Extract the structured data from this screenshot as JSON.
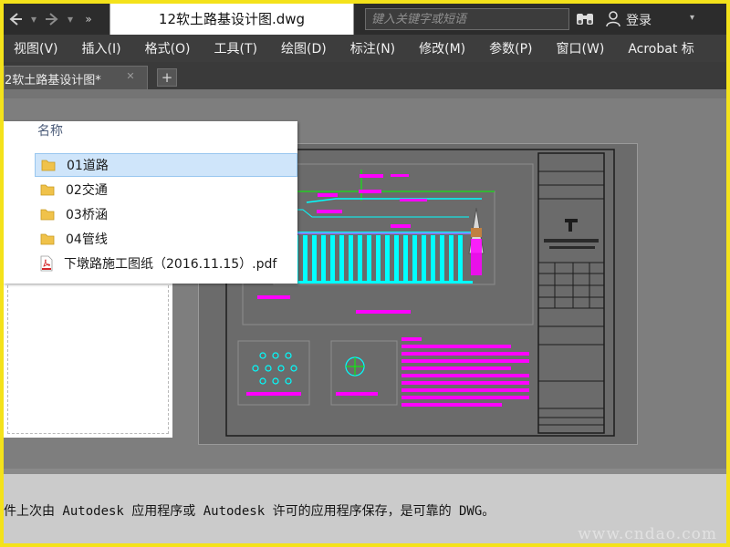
{
  "titlebar": {
    "document_title": "12软土路基设计图.dwg",
    "search_placeholder": "键入关键字或短语",
    "login_label": "登录",
    "back_icon": "back-arrow-icon",
    "forward_icon": "forward-arrow-icon",
    "binoculars_icon": "binoculars-icon",
    "user_icon": "user-icon"
  },
  "menubar": {
    "items": [
      "视图(V)",
      "插入(I)",
      "格式(O)",
      "工具(T)",
      "绘图(D)",
      "标注(N)",
      "修改(M)",
      "参数(P)",
      "窗口(W)",
      "Acrobat 标"
    ]
  },
  "tabs": {
    "active_tab": "2软土路基设计图*",
    "add_tab_icon": "plus-icon",
    "close_icon": "close-icon"
  },
  "file_list": {
    "header": "名称",
    "items": [
      {
        "name": "01道路",
        "type": "folder"
      },
      {
        "name": "02交通",
        "type": "folder"
      },
      {
        "name": "03桥涵",
        "type": "folder"
      },
      {
        "name": "04管线",
        "type": "folder"
      },
      {
        "name": "下墩路施工图纸（2016.11.15）.pdf",
        "type": "pdf"
      }
    ],
    "selected_index": 0
  },
  "status_bar": {
    "message": "件上次由 Autodesk 应用程序或 Autodesk 许可的应用程序保存，是可靠的 DWG。",
    "watermark": "www.cndao.com"
  },
  "colors": {
    "cad_cyan": "#00ffff",
    "cad_magenta": "#ff00ff",
    "cad_green": "#00ff00",
    "frame_yellow": "#f4e21a"
  }
}
